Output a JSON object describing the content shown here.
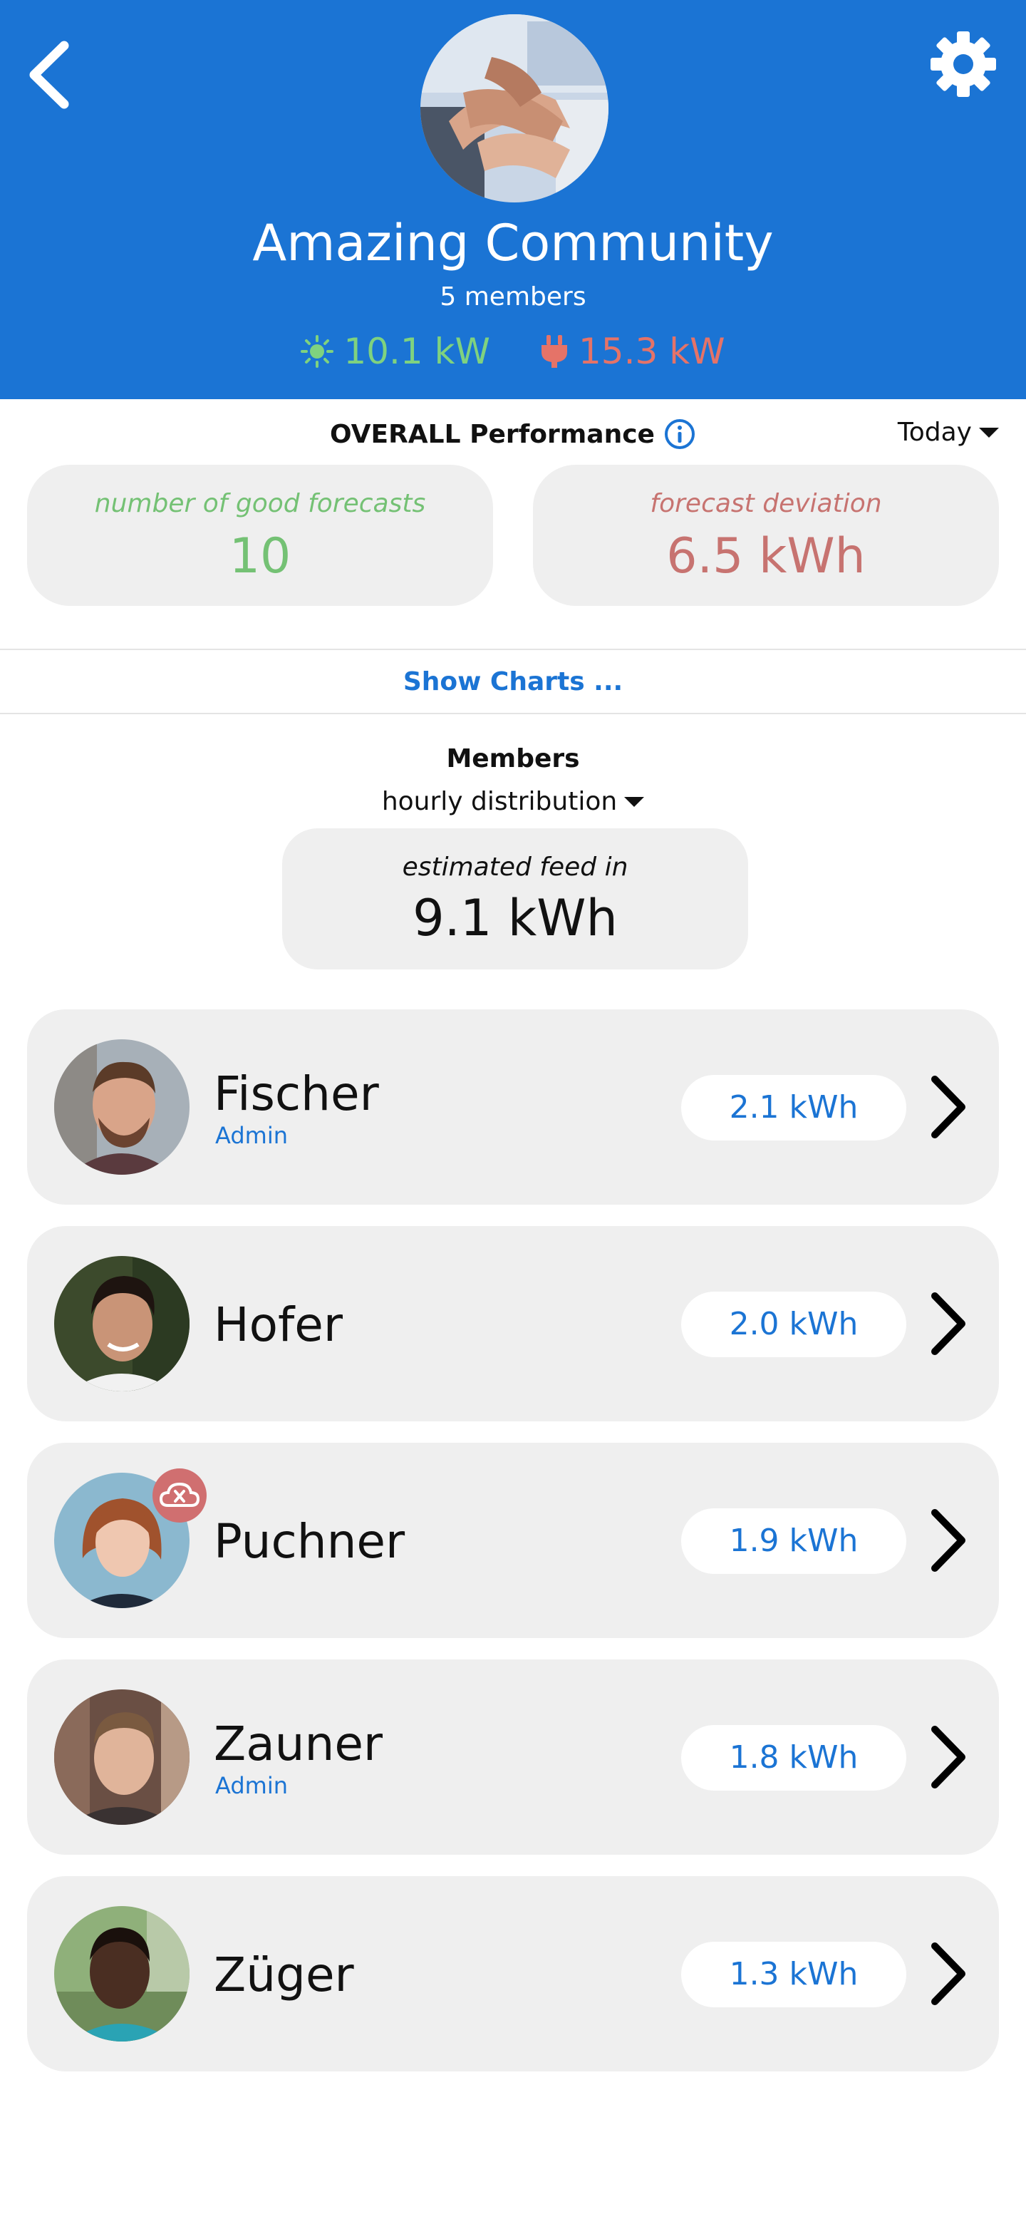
{
  "header": {
    "community_name": "Amazing Community",
    "member_count": "5 members",
    "solar_value": "10.1 kW",
    "grid_value": "15.3 kW",
    "back_icon": "chevron-left-icon",
    "settings_icon": "gear-icon",
    "solar_icon": "sun-icon",
    "grid_icon": "plug-icon",
    "background_color": "#1b74d4",
    "solar_color": "#7fd27f",
    "grid_color": "#e57368"
  },
  "performance": {
    "title": "OVERALL Performance",
    "period": "Today",
    "good_forecasts_label": "number of good forecasts",
    "good_forecasts_value": "10",
    "deviation_label": "forecast deviation",
    "deviation_value": "6.5 kWh"
  },
  "charts_link": "Show Charts ...",
  "members_section": {
    "title": "Members",
    "distribution": "hourly distribution",
    "feed_label": "estimated feed in",
    "feed_value": "9.1 kWh"
  },
  "members": [
    {
      "name": "Fischer",
      "role": "Admin",
      "value": "2.1 kWh",
      "offline": false
    },
    {
      "name": "Hofer",
      "role": "",
      "value": "2.0 kWh",
      "offline": false
    },
    {
      "name": "Puchner",
      "role": "",
      "value": "1.9 kWh",
      "offline": true
    },
    {
      "name": "Zauner",
      "role": "Admin",
      "value": "1.8 kWh",
      "offline": false
    },
    {
      "name": "Züger",
      "role": "",
      "value": "1.3 kWh",
      "offline": false
    }
  ]
}
